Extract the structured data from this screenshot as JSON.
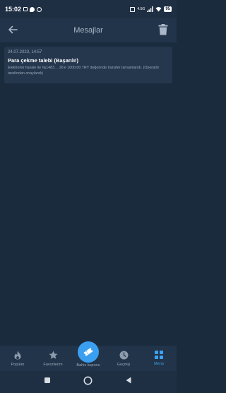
{
  "status_bar": {
    "time": "15:02",
    "network_label": "4.5G",
    "battery": "95"
  },
  "header": {
    "title": "Mesajlar"
  },
  "messages": [
    {
      "date": "24.07.2023, 14:57",
      "title": "Para çekme talebi (Başarılı!)",
      "body": "Elektronik havale ile №1483… 26'e 1000.00 TRY değerinde transfer tamamlandı. (Operatör tarafından onaylandı)"
    }
  ],
  "bottom_nav": {
    "items": [
      {
        "label": "Popüler",
        "icon": "flame-icon"
      },
      {
        "label": "Favorilerim",
        "icon": "star-icon"
      },
      {
        "label": "Bahis kuponu",
        "icon": "ticket-icon"
      },
      {
        "label": "Geçmiş",
        "icon": "clock-icon"
      },
      {
        "label": "Menü",
        "icon": "grid-icon"
      }
    ],
    "active_index": 4
  },
  "colors": {
    "background": "#1b2b3e",
    "card": "#25374d",
    "accent": "#3ea2f2",
    "muted_text": "#9aa8b8"
  }
}
